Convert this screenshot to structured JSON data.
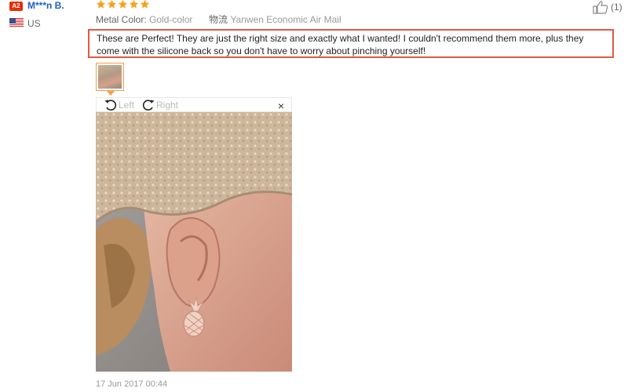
{
  "reviewer": {
    "level_badge": "A2",
    "name": "M***n B.",
    "country": "US",
    "flag_icon": "us-flag-icon"
  },
  "rating": {
    "stars": 5,
    "max": 5,
    "star_color": "#f7a21d"
  },
  "helpful": {
    "count_label": "(1)",
    "icon": "thumbs-up-icon"
  },
  "attributes": [
    {
      "label": "Metal Color:",
      "value": "Gold-color"
    },
    {
      "label": "物流",
      "value": "Yanwen Economic Air Mail"
    }
  ],
  "review_text": "These are Perfect! They are just the right size and exactly what I wanted! I couldn't recommend them more, plus they come with the silicone back so you don't have to worry about pinching yourself!",
  "highlight_color": "#e2593f",
  "photo_viewer": {
    "rotate_left_label": "Left",
    "rotate_right_label": "Right",
    "close_label": "×"
  },
  "timestamp": "17 Jun 2017 00:44"
}
